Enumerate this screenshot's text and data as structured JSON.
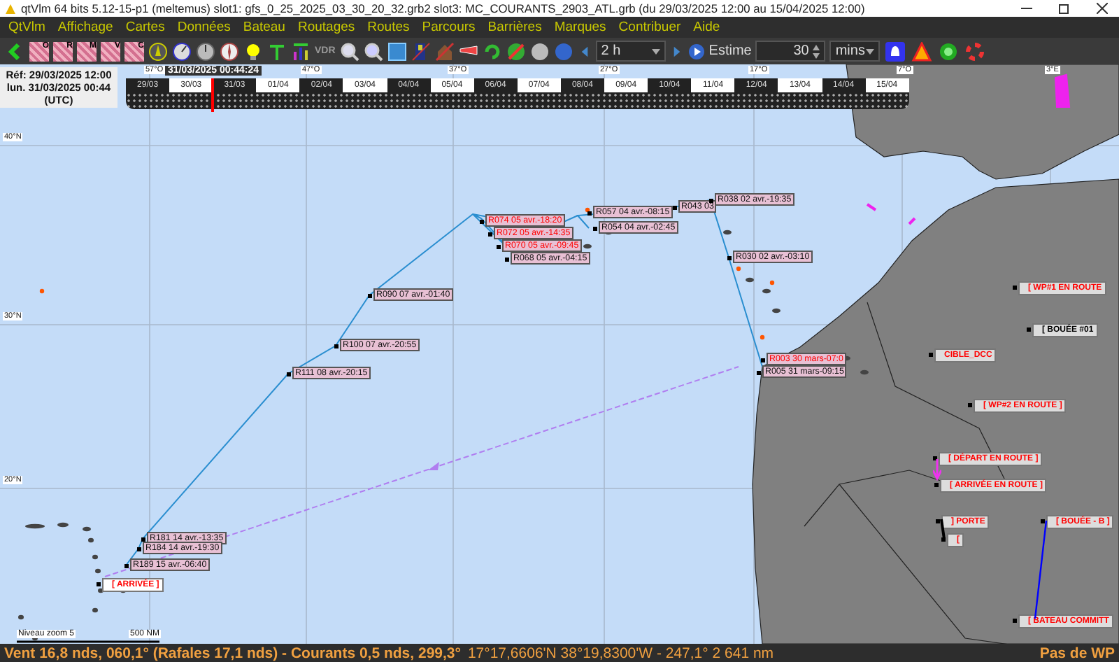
{
  "window": {
    "title": "qtVlm 64 bits 5.12-15-p1 (meltemus) slot1: gfs_0_25_2025_03_30_20_32.grb2 slot3: MC_COURANTS_2903_ATL.grb (du 29/03/2025 12:00 au 15/04/2025 12:00)"
  },
  "menu": [
    "QtVlm",
    "Affichage",
    "Cartes",
    "Données",
    "Bateau",
    "Routages",
    "Routes",
    "Parcours",
    "Barrières",
    "Marques",
    "Contribuer",
    "Aide"
  ],
  "toolbar": {
    "grib_buttons": [
      "O",
      "R",
      "M",
      "V",
      "C"
    ],
    "vdr_label": "VDR",
    "step": "2 h",
    "estimate_button": "Estime",
    "estimate_value": "30",
    "estimate_unit": "mins"
  },
  "map": {
    "info": {
      "reference": "Réf: 29/03/2025 12:00",
      "current": "lun. 31/03/2025 00:44",
      "timezone": "(UTC)"
    },
    "timeline": {
      "cursor_time": "31/03/2025 00:44:24",
      "level": 0.11,
      "dates": [
        "29/03",
        "30/03",
        "31/03",
        "01/04",
        "02/04",
        "03/04",
        "04/04",
        "05/04",
        "06/04",
        "07/04",
        "08/04",
        "09/04",
        "10/04",
        "11/04",
        "12/04",
        "13/04",
        "14/04",
        "15/04"
      ]
    },
    "longitude_labels": [
      "57°O",
      "47°O",
      "37°O",
      "27°O",
      "17°O",
      "7°O",
      "3°E"
    ],
    "latitude_labels": [
      "40°N",
      "30°N",
      "20°N"
    ],
    "route_points": [
      {
        "label": "R043 03",
        "highlighted": false
      },
      {
        "label": "R038 02 avr.-19:35",
        "highlighted": false
      },
      {
        "label": "R057 04 avr.-08:15",
        "highlighted": false
      },
      {
        "label": "R054 04 avr.-02:45",
        "highlighted": false
      },
      {
        "label": "R030 02 avr.-03:10",
        "highlighted": false
      },
      {
        "label": "R074 05 avr.-18:20",
        "highlighted": true
      },
      {
        "label": "R072 05 avr.-14:35",
        "highlighted": true
      },
      {
        "label": "R070 05 avr.-09:45",
        "highlighted": true
      },
      {
        "label": "R068 05 avr.-04:15",
        "highlighted": false
      },
      {
        "label": "R090 07 avr.-01:40",
        "highlighted": false
      },
      {
        "label": "R100 07 avr.-20:55",
        "highlighted": false
      },
      {
        "label": "R111 08 avr.-20:15",
        "highlighted": false
      },
      {
        "label": "R181 14 avr.-13:35",
        "highlighted": false
      },
      {
        "label": "R184 14 avr.-19:30",
        "highlighted": false
      },
      {
        "label": "R189 15 avr.-06:40",
        "highlighted": false
      },
      {
        "label": "R003 30 mars-07:0",
        "highlighted": true
      },
      {
        "label": "R005 31 mars-09:15",
        "highlighted": false
      }
    ],
    "marks": [
      {
        "label": "[ ARRIVÉE ]",
        "color": "#ff0000"
      },
      {
        "label": "[ WP#1 EN ROUTE",
        "color": "#ff0000"
      },
      {
        "label": "[ BOUÉE #01",
        "color": "#000000"
      },
      {
        "label": "CIBLE_DCC",
        "color": "#ff0000"
      },
      {
        "label": "[ WP#2 EN ROUTE ]",
        "color": "#ff0000"
      },
      {
        "label": "[ DÉPART EN ROUTE ]",
        "color": "#ff0000"
      },
      {
        "label": "[ ARRIVÉE EN ROUTE ]",
        "color": "#ff0000"
      },
      {
        "label": "] PORTE",
        "color": "#ff0000"
      },
      {
        "label": "[",
        "color": "#ff0000"
      },
      {
        "label": "[ BOUÉE - B ]",
        "color": "#ff0000"
      },
      {
        "label": "[ BATEAU COMMITT",
        "color": "#ff0000"
      }
    ],
    "scale": {
      "zoom": "Niveau zoom 5",
      "distance": "500 NM"
    }
  },
  "status": {
    "wind": "Vent 16,8 nds, 060,1° (Rafales 17,1 nds) - Courants 0,5 nds, 299,3°",
    "position": "17°17,6606'N 38°19,8300'W - 247,1° 2 641 nm",
    "waypoint": "Pas de WP"
  }
}
